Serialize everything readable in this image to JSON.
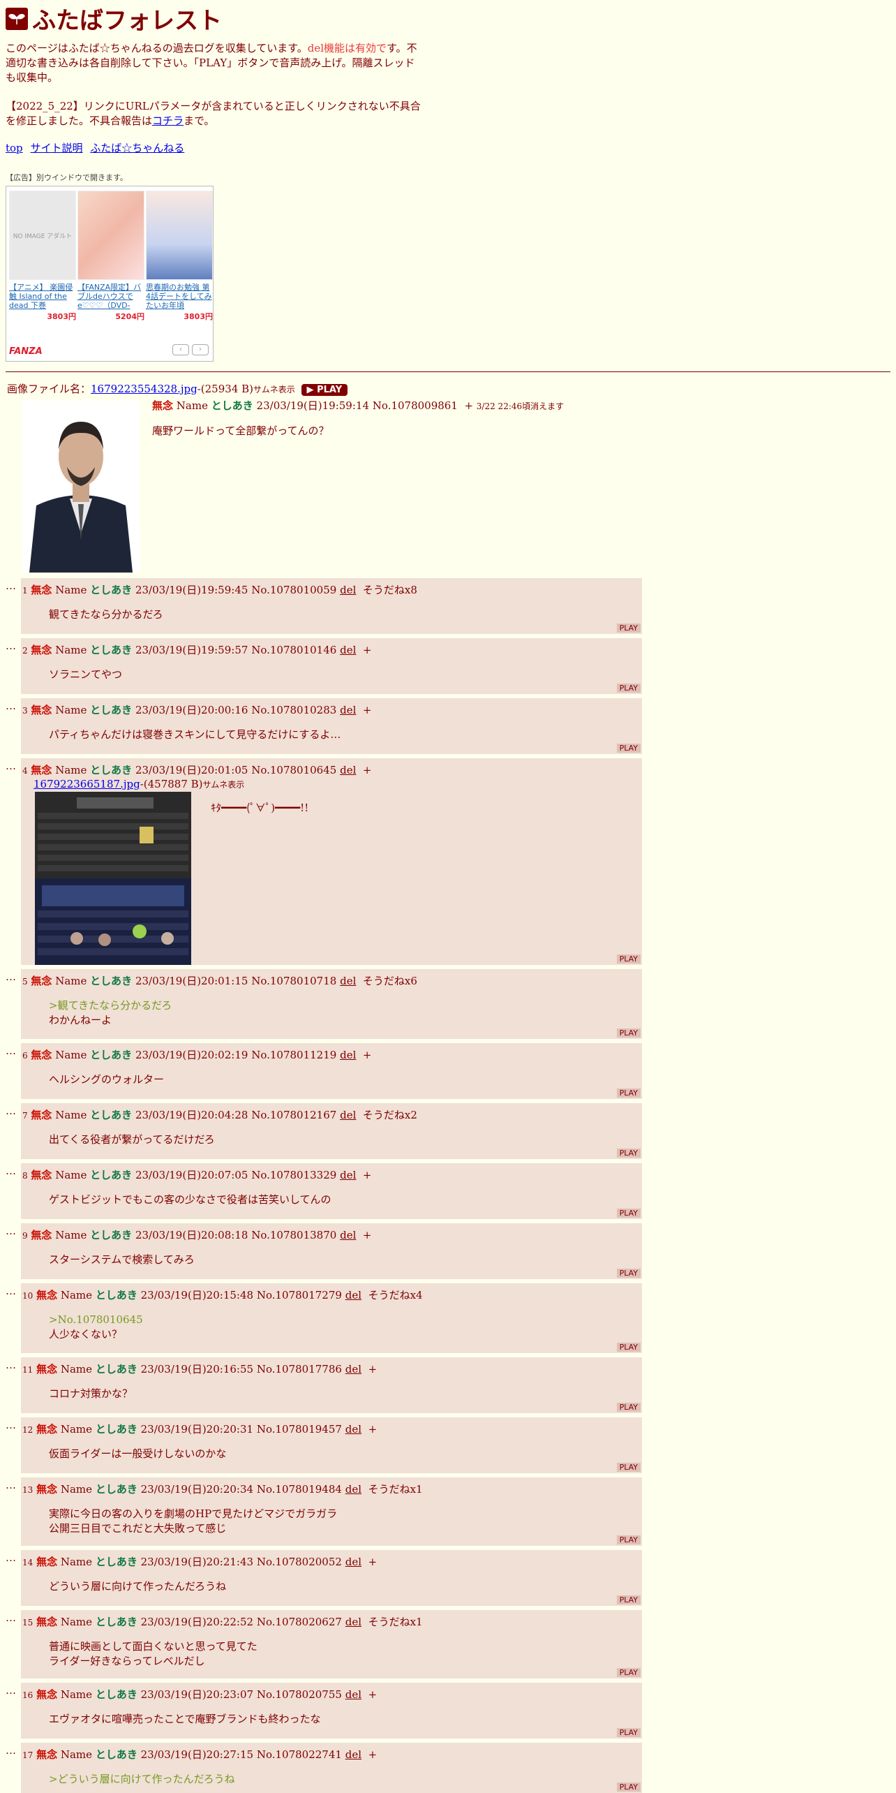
{
  "site": {
    "title": "ふたばフォレスト",
    "desc_1": "このページはふたば☆ちゃんねるの過去ログを収集しています。",
    "desc_red": "del機能は有効で",
    "desc_red2": "す。",
    "desc_2": "不適切な書き込みは各自削除して下さい。「PLAY」ボタンで音声読み上げ。隔離スレッドも収集中。",
    "notice_1": "【2022_5_22】リンクにURLパラメータが含まれていると正しくリンクされない不具合を修正しました。不具合報告は",
    "notice_link": "コチラ",
    "notice_2": "まで。",
    "nav": [
      "top",
      "サイト説明",
      "ふたば☆ちゃんねる"
    ]
  },
  "ad": {
    "label": "【広告】別ウインドウで開きます。",
    "brand": "FANZA",
    "items": [
      {
        "title": "【アニメ】 楽園侵触 Island of the dead 下巻",
        "price": "3803円",
        "img_text": "NO IMAGE アダルト",
        "color": "#e8e8e8"
      },
      {
        "title": "【FANZA限定】バブルdeハウスでe♡♡♡（DVD-PG） オリジナ…",
        "price": "5204円",
        "img_text": "",
        "color": "#f4c7b5"
      },
      {
        "title": "思春期のお勉強 第4話デートをしてみたいお年頃",
        "price": "3803円",
        "img_text": "",
        "color": "#c8d4f0"
      }
    ]
  },
  "op": {
    "file_label": "画像ファイル名：",
    "file_name": "1679223554328.jpg",
    "file_size": "-(25934 B)",
    "thumb_label": "サムネ表示",
    "play": "PLAY",
    "subject": "無念",
    "name_label": "Name",
    "name": "としあき",
    "date": "23/03/19(日)19:59:14",
    "no": "No.1078009861",
    "plus": "+",
    "expire": "3/22 22:46頃消えます",
    "body": "庵野ワールドって全部繋がってんの？"
  },
  "replies": [
    {
      "n": "1",
      "date": "23/03/19(日)19:59:45",
      "no": "No.1078010059",
      "soudane": "そうだねx8",
      "lines": [
        "観てきたなら分かるだろ"
      ]
    },
    {
      "n": "2",
      "date": "23/03/19(日)19:59:57",
      "no": "No.1078010146",
      "soudane": "+",
      "lines": [
        "ソラニンてやつ"
      ]
    },
    {
      "n": "3",
      "date": "23/03/19(日)20:00:16",
      "no": "No.1078010283",
      "soudane": "+",
      "lines": [
        "パティちゃんだけは寝巻きスキンにして見守るだけにするよ…"
      ]
    },
    {
      "n": "4",
      "date": "23/03/19(日)20:01:05",
      "no": "No.1078010645",
      "soudane": "+",
      "file": "1679223665187.jpg",
      "file_size": "-(457887 B)",
      "thumb": "サムネ表示",
      "lines": [
        "ｷﾀ━━━━(ﾟ∀ﾟ)━━━━!!"
      ]
    },
    {
      "n": "5",
      "date": "23/03/19(日)20:01:15",
      "no": "No.1078010718",
      "soudane": "そうだねx6",
      "quote": ">観てきたなら分かるだろ",
      "lines": [
        "わかんねーよ"
      ]
    },
    {
      "n": "6",
      "date": "23/03/19(日)20:02:19",
      "no": "No.1078011219",
      "soudane": "+",
      "lines": [
        "ヘルシングのウォルター"
      ]
    },
    {
      "n": "7",
      "date": "23/03/19(日)20:04:28",
      "no": "No.1078012167",
      "soudane": "そうだねx2",
      "lines": [
        "出てくる役者が繋がってるだけだろ"
      ]
    },
    {
      "n": "8",
      "date": "23/03/19(日)20:07:05",
      "no": "No.1078013329",
      "soudane": "+",
      "lines": [
        "ゲストビジットでもこの客の少なさで役者は苦笑いしてんの"
      ]
    },
    {
      "n": "9",
      "date": "23/03/19(日)20:08:18",
      "no": "No.1078013870",
      "soudane": "+",
      "lines": [
        "スターシステムで検索してみろ"
      ]
    },
    {
      "n": "10",
      "date": "23/03/19(日)20:15:48",
      "no": "No.1078017279",
      "soudane": "そうだねx4",
      "quote": ">No.1078010645",
      "lines": [
        "人少なくない？"
      ]
    },
    {
      "n": "11",
      "date": "23/03/19(日)20:16:55",
      "no": "No.1078017786",
      "soudane": "+",
      "lines": [
        "コロナ対策かな？"
      ]
    },
    {
      "n": "12",
      "date": "23/03/19(日)20:20:31",
      "no": "No.1078019457",
      "soudane": "+",
      "lines": [
        "仮面ライダーは一般受けしないのかな"
      ]
    },
    {
      "n": "13",
      "date": "23/03/19(日)20:20:34",
      "no": "No.1078019484",
      "soudane": "そうだねx1",
      "lines": [
        "実際に今日の客の入りを劇場のHPで見たけどマジでガラガラ",
        "公開三日目でこれだと大失敗って感じ"
      ]
    },
    {
      "n": "14",
      "date": "23/03/19(日)20:21:43",
      "no": "No.1078020052",
      "soudane": "+",
      "lines": [
        "どういう層に向けて作ったんだろうね"
      ]
    },
    {
      "n": "15",
      "date": "23/03/19(日)20:22:52",
      "no": "No.1078020627",
      "soudane": "そうだねx1",
      "lines": [
        "普通に映画として面白くないと思って見てた",
        "ライダー好きならってレベルだし"
      ]
    },
    {
      "n": "16",
      "date": "23/03/19(日)20:23:07",
      "no": "No.1078020755",
      "soudane": "+",
      "lines": [
        "エヴァオタに喧嘩売ったことで庵野ブランドも終わったな"
      ]
    },
    {
      "n": "17",
      "date": "23/03/19(日)20:27:15",
      "no": "No.1078022741",
      "soudane": "+",
      "quote": ">どういう層に向けて作ったんだろうね",
      "lines": [
        ""
      ]
    }
  ],
  "labels": {
    "dots": "…",
    "subject": "無念",
    "name_label": "Name",
    "name": "としあき",
    "del": "del",
    "play": "PLAY"
  }
}
